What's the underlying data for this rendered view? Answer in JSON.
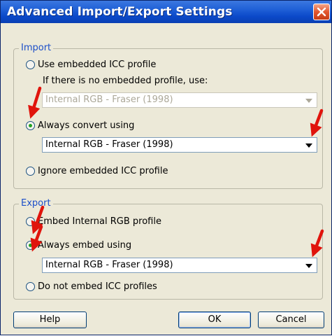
{
  "window": {
    "title": "Advanced Import/Export Settings"
  },
  "import_group": {
    "legend": "Import",
    "use_embedded_label": "Use embedded ICC profile",
    "fallback_note": "If there is no embedded profile, use:",
    "fallback_select_value": "Internal RGB - Fraser (1998)",
    "always_convert_label": "Always convert using",
    "convert_select_value": "Internal RGB - Fraser (1998)",
    "ignore_label": "Ignore embedded ICC profile",
    "selected": "always_convert"
  },
  "export_group": {
    "legend": "Export",
    "embed_internal_label": "Embed Internal RGB profile",
    "always_embed_label": "Always embed using",
    "embed_select_value": "Internal RGB - Fraser (1998)",
    "do_not_embed_label": "Do not embed ICC profiles",
    "selected": "always_embed"
  },
  "buttons": {
    "help": "Help",
    "ok": "OK",
    "cancel": "Cancel"
  },
  "colors": {
    "title_bar": "#0b49c9",
    "close_button": "#e2562f",
    "dialog_bg": "#ece9d8",
    "legend_text": "#1c4fc9",
    "radio_dot": "#21a121",
    "annotation_arrow": "#e0140c"
  },
  "annotations": {
    "arrow_icon": "red-arrow-icon",
    "count": 5
  }
}
